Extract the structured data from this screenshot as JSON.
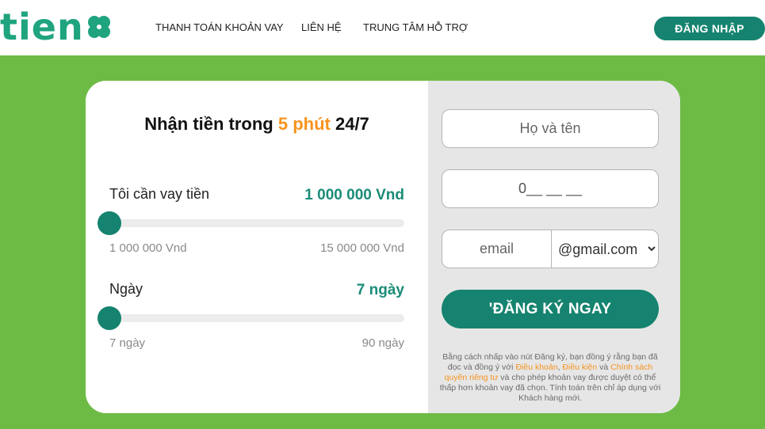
{
  "header": {
    "logo_text": "tien",
    "nav": [
      "THANH TOÁN KHOẢN VAY",
      "LIÊN HỆ",
      "TRUNG TÂM HỖ TRỢ"
    ],
    "login_label": "ĐĂNG NHẬP"
  },
  "calculator": {
    "headline_pre": "Nhận tiền trong ",
    "headline_highlight": "5 phút",
    "headline_post": " 24/7",
    "amount": {
      "label": "Tôi cần vay tiền",
      "value": "1 000 000 Vnd",
      "min": "1 000 000 Vnd",
      "max": "15 000 000 Vnd",
      "position": 0
    },
    "days": {
      "label": "Ngày",
      "value": "7 ngày",
      "min": "7 ngày",
      "max": "90 ngày",
      "position": 0
    }
  },
  "form": {
    "name_placeholder": "Họ và tên",
    "phone_value": "0__ __ __",
    "email_placeholder": "email",
    "domain_selected": "@gmail.com",
    "submit_label": "'ĐĂNG KÝ NGAY",
    "legal_1": "Bằng cách nhấp vào nút Đăng ký, bạn đồng ý rằng bạn đã đọc và đồng ý với ",
    "legal_link_1": "Điều khoản",
    "legal_sep": ", ",
    "legal_link_2": "Điều kiện",
    "legal_and": " và ",
    "legal_link_3": "Chính sách quyền riêng tư",
    "legal_2": " và cho phép khoản vay được duyệt có thể thấp hơn khoản vay đã chọn. Tính toán trên chỉ áp dụng với Khách hàng mới."
  },
  "colors": {
    "brand_green": "#15836f",
    "accent_orange": "#f7931e",
    "page_green": "#6dbb45"
  }
}
